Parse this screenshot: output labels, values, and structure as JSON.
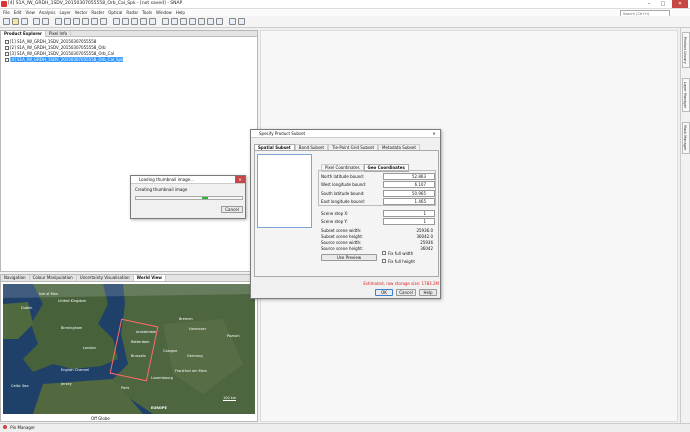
{
  "window": {
    "title": "[4] S1A_IW_GRDH_1SDV_20150307055558_Orb_Cal_Spk - [not saved] - SNAP",
    "search_placeholder": "Search (Ctrl+I)",
    "controls": [
      "–",
      "□",
      "✕"
    ]
  },
  "menubar": [
    "File",
    "Edit",
    "View",
    "Analysis",
    "Layer",
    "Vector",
    "Raster",
    "Optical",
    "Radar",
    "Tools",
    "Window",
    "Help"
  ],
  "left_tabs": {
    "product_explorer": "Product Explorer",
    "pixel_info": "Pixel Info"
  },
  "products": [
    "[1] S1A_IW_GRDH_1SDV_20150307055558",
    "[2] S1A_IW_GRDH_1SDV_20150307055558_Orb",
    "[3] S1A_IW_GRDH_1SDV_20150307055558_Orb_Cal",
    "[4] S1A_IW_GRDH_1SDV_20150307055558_Orb_Cal_Spk"
  ],
  "bottom_tabs": [
    "Navigation",
    "Colour Manipulation",
    "Uncertainty Visualisation",
    "World View"
  ],
  "map": {
    "labels": [
      "Isle of Man",
      "United Kingdom",
      "Dublin",
      "Birmingham",
      "London",
      "Amsterdam",
      "Bremen",
      "Hannover",
      "Rotterdam",
      "Germany",
      "Brussels",
      "Cologne",
      "Frankfurt am Main",
      "Luxembourg",
      "English Channel",
      "Jersey",
      "Paris",
      "EUROPE",
      "Celtic Sea",
      "Poznań"
    ],
    "footer": "Off Globe",
    "scale": "100 km"
  },
  "thumb_dialog": {
    "title": "Loading thumbnail image...",
    "message": "Creating thumbnail image",
    "cancel": "Cancel"
  },
  "subset_dialog": {
    "title": "Specify Product Subset",
    "tabs": [
      "Spatial Subset",
      "Band Subset",
      "Tie-Point Grid Subset",
      "Metadata Subset"
    ],
    "subtabs": [
      "Pixel Coordinates",
      "Geo Coordinates"
    ],
    "geo_fields": [
      {
        "label": "North latitude bound:",
        "value": "52.863"
      },
      {
        "label": "West longitude bound:",
        "value": "6.107"
      },
      {
        "label": "South latitude bound:",
        "value": "50.965"
      },
      {
        "label": "East longitude bound:",
        "value": "1.465"
      }
    ],
    "step_fields": [
      {
        "label": "Scene step X:",
        "value": "1"
      },
      {
        "label": "Scene step Y:",
        "value": "1"
      }
    ],
    "info": [
      {
        "label": "Subset scene width:",
        "value": "25936.0"
      },
      {
        "label": "Subset scene height:",
        "value": "36042.0"
      },
      {
        "label": "Source scene width:",
        "value": "25936"
      },
      {
        "label": "Source scene height:",
        "value": "36042"
      }
    ],
    "use_preview": "Use Preview",
    "fix_width": "Fix full width",
    "fix_height": "Fix full height",
    "estimate": "Estimated, raw storage size: 1783.2M",
    "buttons": [
      "OK",
      "Cancel",
      "Help"
    ]
  },
  "right_tabs": [
    "Product Library",
    "Layer Manager",
    "Mask Manager"
  ],
  "status": "Pin Manager"
}
